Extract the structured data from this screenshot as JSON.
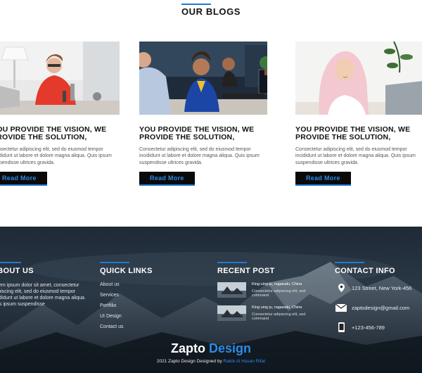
{
  "blogs": {
    "title": "OUR BLOGS",
    "cards": [
      {
        "heading": "YOU PROVIDE THE VISION, WE PROVIDE THE SOLUTION,",
        "text": "Consectetur adipiscing elit, sed do eiusmod tempor incididunt ut labore et dolore magna aliqua. Quis ipsum suspendisse ultrices gravida.",
        "button": "Read More"
      },
      {
        "heading": "YOU PROVIDE THE VISION, WE PROVIDE THE SOLUTION,",
        "text": "Consectetur adipiscing elit, sed do eiusmod tempor incididunt ut labore et dolore magna aliqua. Quis ipsum suspendisse ultrices gravida.",
        "button": "Read More"
      },
      {
        "heading": "YOU PROVIDE THE VISION, WE PROVIDE THE SOLUTION,",
        "text": "Consectetur adipiscing elit, sed do eiusmod tempor incididunt ut labore et dolore magna aliqua. Quis ipsum suspendisse ultrices gravida.",
        "button": "Read More"
      }
    ]
  },
  "footer": {
    "about": {
      "title": "ABOUT US",
      "text": "Lorem ipsum dolor sit amet, consectetur adipiscing elit, sed do eiusmod tempor incididunt ut labore et dolore magna aliqua. Quis ipsum suspendisse"
    },
    "links": {
      "title": "QUICK LINKS",
      "items": [
        "About us",
        "Services",
        "Portfilio",
        "UI Design",
        "Contact us"
      ]
    },
    "recent": {
      "title": "RECENT POST",
      "posts": [
        {
          "title": "King uing ju, nagasaki, China",
          "desc": "Consectetur adipiscing elit, sed command"
        },
        {
          "title": "King uing ju, nagasaki, China",
          "desc": "Consectetur adipiscing elit, sed command"
        }
      ]
    },
    "contact": {
      "title": "CONTACT INFO",
      "address": "123 Street, New York-456",
      "email": "zaptodesign@gmail.com",
      "phone": "+123-456-789",
      "icons": [
        "location-pin-icon",
        "envelope-icon",
        "phone-icon"
      ]
    },
    "brand": {
      "part1": "Zapto",
      "part2": "Design"
    },
    "copyright": {
      "prefix": "2021 Zapto Design Designed by",
      "author": "Rakib Al Hasan Rifat"
    }
  },
  "colors": {
    "accent": "#1e7bd6",
    "button_bg": "#0a0a0a",
    "footer_bg": "#1b2530"
  }
}
